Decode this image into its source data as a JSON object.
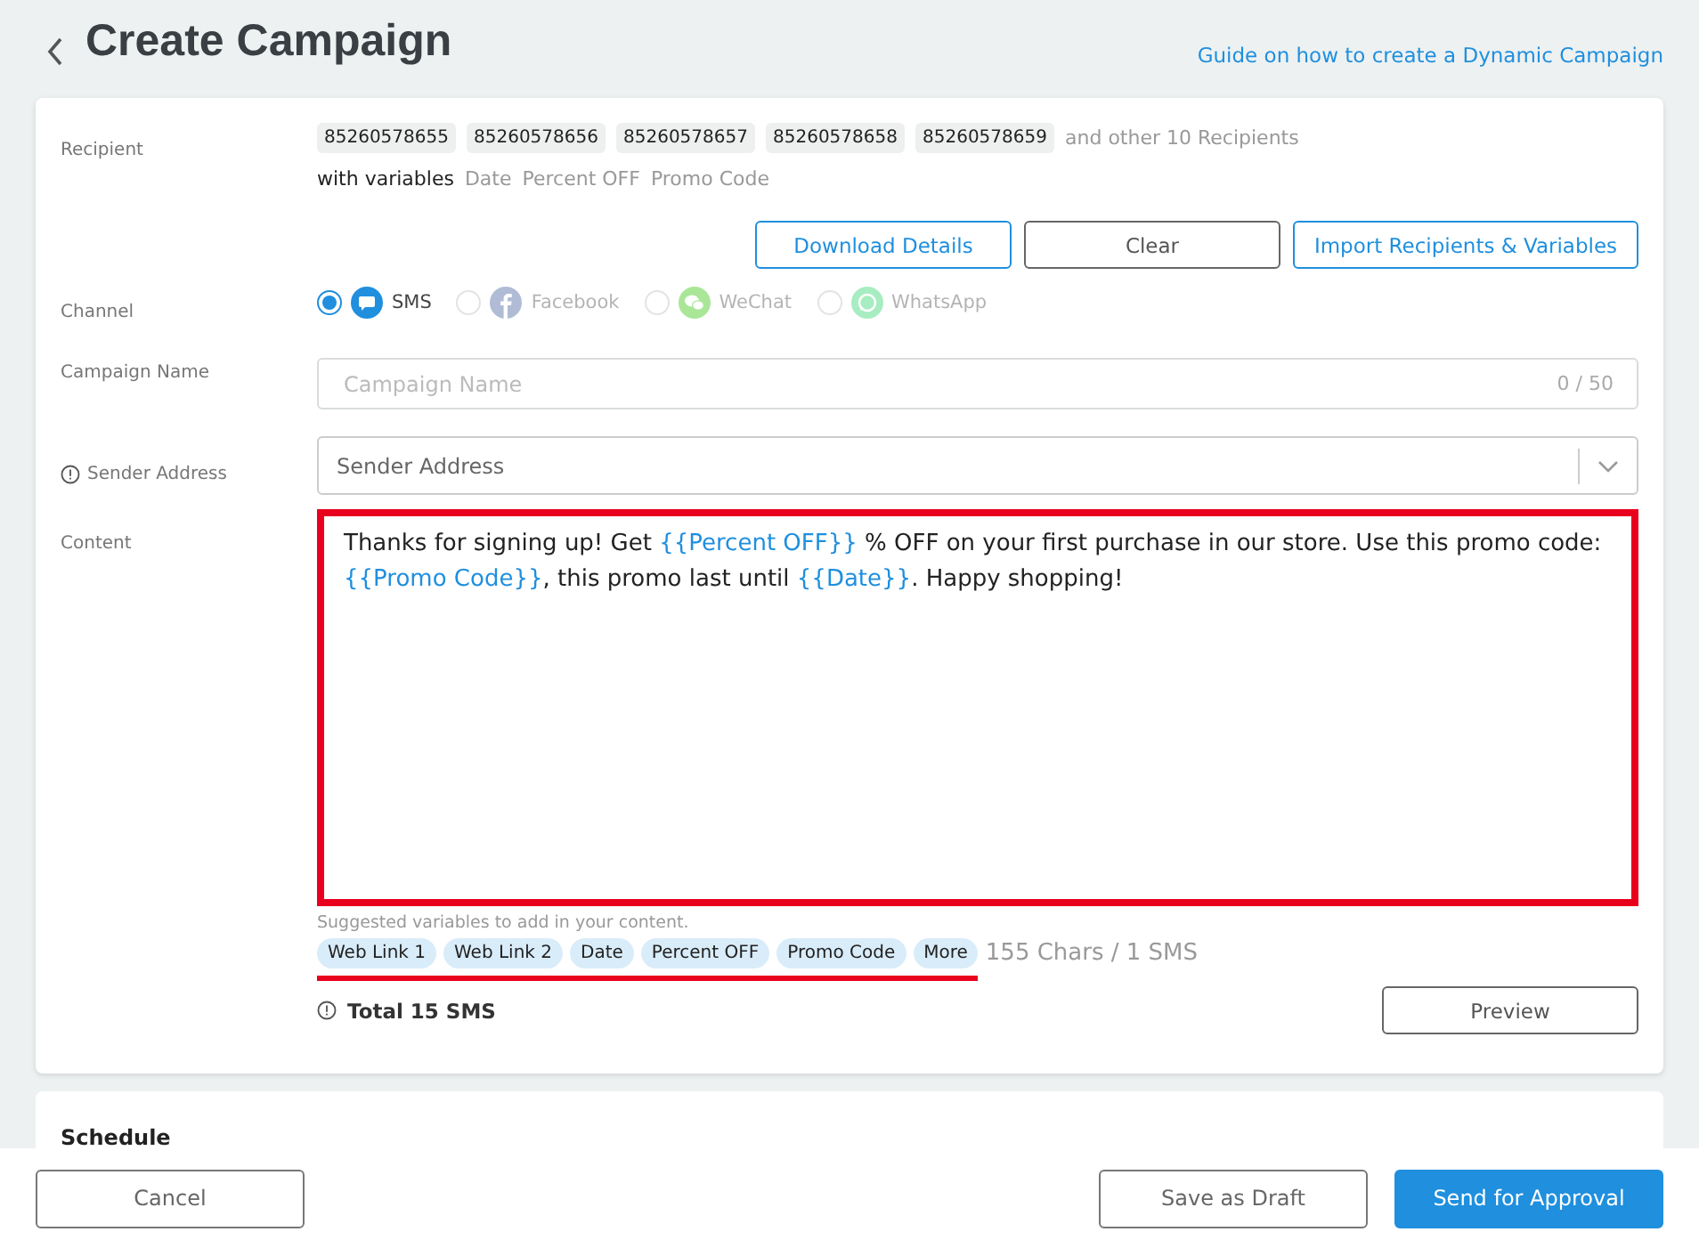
{
  "header": {
    "title": "Create Campaign",
    "guide_link": "Guide on how to create a Dynamic Campaign"
  },
  "recipient": {
    "label": "Recipient",
    "numbers": [
      "85260578655",
      "85260578656",
      "85260578657",
      "85260578658",
      "85260578659"
    ],
    "more": "and other 10 Recipients",
    "variables_label": "with variables",
    "variables": [
      "Date",
      "Percent OFF",
      "Promo Code"
    ],
    "buttons": [
      "Download Details",
      "Clear",
      "Import Recipients & Variables"
    ]
  },
  "channel": {
    "label": "Channel",
    "options": [
      {
        "kind": "sms",
        "label": "SMS",
        "selected": true,
        "disabled": false
      },
      {
        "kind": "facebook",
        "label": "Facebook",
        "selected": false,
        "disabled": true
      },
      {
        "kind": "wechat",
        "label": "WeChat",
        "selected": false,
        "disabled": true
      },
      {
        "kind": "whatsapp",
        "label": "WhatsApp",
        "selected": false,
        "disabled": true
      }
    ]
  },
  "campaign_name": {
    "label": "Campaign Name",
    "placeholder": "Campaign Name",
    "counter": "0 / 50"
  },
  "sender": {
    "label": "Sender Address",
    "placeholder": "Sender Address"
  },
  "content": {
    "label": "Content",
    "highlighted": true,
    "segments": [
      {
        "kind": "text",
        "text": "Thanks for signing up! Get "
      },
      {
        "kind": "variable",
        "text": "{{Percent OFF}}"
      },
      {
        "kind": "text",
        "text": " % OFF on your first purchase in our store. Use this promo code: "
      },
      {
        "kind": "variable",
        "text": "{{Promo Code}}"
      },
      {
        "kind": "text",
        "text": ", this promo last until "
      },
      {
        "kind": "variable",
        "text": "{{Date}}"
      },
      {
        "kind": "text",
        "text": ". Happy shopping!"
      }
    ],
    "hint": "Suggested variables to add in your content.",
    "suggested": [
      "Web Link 1",
      "Web Link 2",
      "Date",
      "Percent OFF",
      "Promo Code",
      "More"
    ],
    "underlined": true,
    "char_count": "155 Chars / 1 SMS",
    "total": "Total 15 SMS",
    "preview": "Preview"
  },
  "schedule": {
    "title": "Schedule"
  },
  "footer": {
    "cancel": "Cancel",
    "draft": "Save as Draft",
    "submit": "Send for Approval"
  }
}
